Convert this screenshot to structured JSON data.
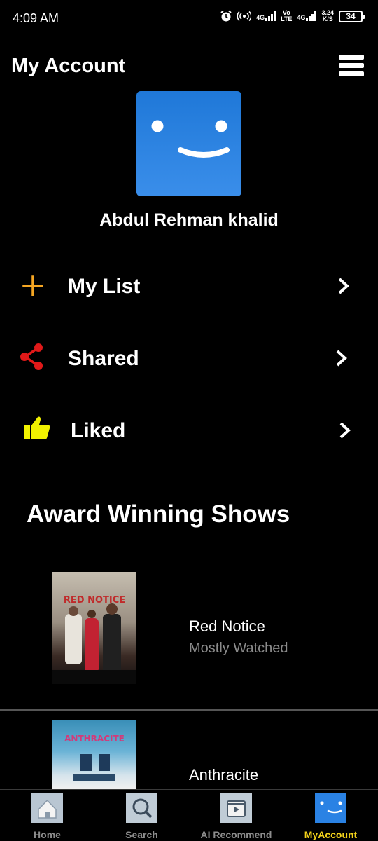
{
  "status_bar": {
    "time": "4:09 AM",
    "net1": "4G",
    "net2_top": "Vo",
    "net2_bottom": "LTE",
    "net3": "4G",
    "speed_value": "3.24",
    "speed_unit": "K/S",
    "battery": "34",
    "icons": [
      "alarm-icon",
      "hotspot-icon",
      "signal-icon",
      "battery-icon"
    ]
  },
  "header": {
    "title": "My Account",
    "menu_icon": "hamburger-menu-icon"
  },
  "profile": {
    "name": "Abdul Rehman khalid",
    "avatar_color": "#2a82e4"
  },
  "menu": {
    "items": [
      {
        "label": "My List",
        "icon": "plus-icon",
        "color": "#f5a623"
      },
      {
        "label": "Shared",
        "icon": "share-icon",
        "color": "#e01919"
      },
      {
        "label": "Liked",
        "icon": "thumbs-up-icon",
        "color": "#f2f200"
      }
    ]
  },
  "section": {
    "title": "Award Winning Shows"
  },
  "shows": [
    {
      "title": "Red Notice",
      "subtitle": "Mostly Watched",
      "poster_text": "RED NOTICE"
    },
    {
      "title": "Anthracite",
      "poster_text": "ANTHRACITE"
    }
  ],
  "bottom_nav": {
    "active_color": "#f3d21a",
    "items": [
      {
        "label": "Home",
        "icon": "home-icon"
      },
      {
        "label": "Search",
        "icon": "search-icon"
      },
      {
        "label": "AI Recommend",
        "icon": "ai-recommend-icon"
      },
      {
        "label": "MyAccount",
        "icon": "account-smile-icon",
        "active": true
      }
    ]
  }
}
